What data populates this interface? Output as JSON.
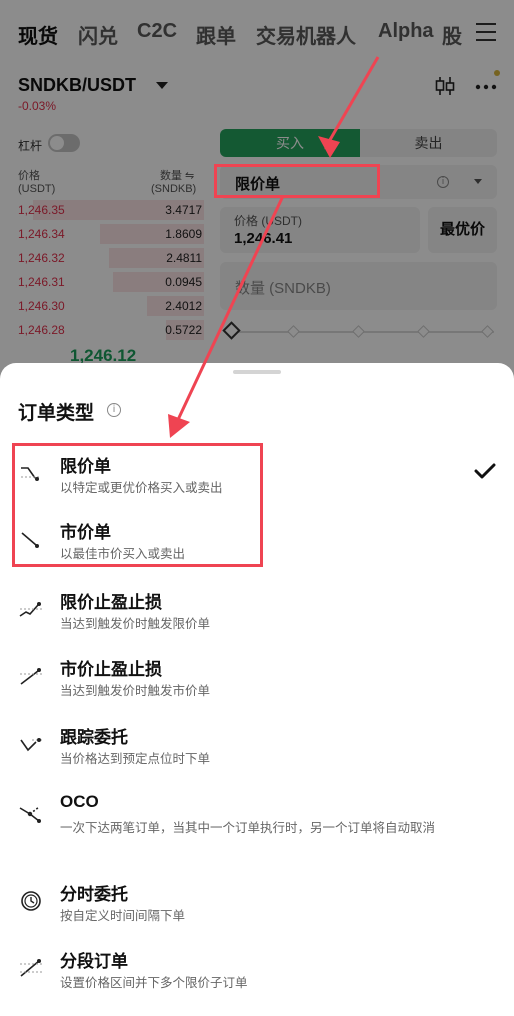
{
  "nav": {
    "tabs": [
      {
        "label": "现货",
        "active": true
      },
      {
        "label": "闪兑"
      },
      {
        "label": "C2C"
      },
      {
        "label": "跟单"
      },
      {
        "label": "交易机器人"
      },
      {
        "label": "Alpha"
      },
      {
        "label": "股"
      }
    ]
  },
  "ticker": {
    "pair": "SNDKB/USDT",
    "change": "-0.03%"
  },
  "leverage_label": "杠杆",
  "orderbook": {
    "price_header": "价格",
    "price_unit": "(USDT)",
    "qty_header": "数量 ⇋",
    "qty_unit": "(SNDKB)",
    "asks": [
      {
        "price": "1,246.35",
        "qty": "3.4717",
        "depth": 0.9
      },
      {
        "price": "1,246.34",
        "qty": "1.8609",
        "depth": 0.55
      },
      {
        "price": "1,246.32",
        "qty": "2.4811",
        "depth": 0.5
      },
      {
        "price": "1,246.31",
        "qty": "0.0945",
        "depth": 0.48
      },
      {
        "price": "1,246.30",
        "qty": "2.4012",
        "depth": 0.3
      },
      {
        "price": "1,246.28",
        "qty": "0.5722",
        "depth": 0.2
      }
    ],
    "last_price": "1,246.12"
  },
  "form": {
    "buy_label": "买入",
    "sell_label": "卖出",
    "order_type": "限价单",
    "price_label": "价格 (USDT)",
    "price_value": "1,246.41",
    "best_price_label": "最优价",
    "qty_placeholder": "数量 (SNDKB)"
  },
  "sheet": {
    "title": "订单类型",
    "options": [
      {
        "title": "限价单",
        "desc": "以特定或更优价格买入或卖出",
        "icon": "limit-order-icon",
        "selected": true
      },
      {
        "title": "市价单",
        "desc": "以最佳市价买入或卖出",
        "icon": "market-order-icon"
      },
      {
        "title": "限价止盈止损",
        "desc": "当达到触发价时触发限价单",
        "icon": "limit-tpsl-icon"
      },
      {
        "title": "市价止盈止损",
        "desc": "当达到触发价时触发市价单",
        "icon": "market-tpsl-icon"
      },
      {
        "title": "跟踪委托",
        "desc": "当价格达到预定点位时下单",
        "icon": "trailing-order-icon"
      },
      {
        "title": "OCO",
        "desc": "一次下达两笔订单，当其中一个订单执行时，另一个订单将自动取消",
        "icon": "oco-icon"
      },
      {
        "title": "分时委托",
        "desc": "按自定义时间间隔下单",
        "icon": "twap-clock-icon"
      },
      {
        "title": "分段订单",
        "desc": "设置价格区间并下多个限价子订单",
        "icon": "scaled-order-icon"
      }
    ]
  },
  "colors": {
    "accent_green": "#25a35e",
    "ask_red": "#e0304b",
    "highlight_red": "#ef4452"
  }
}
